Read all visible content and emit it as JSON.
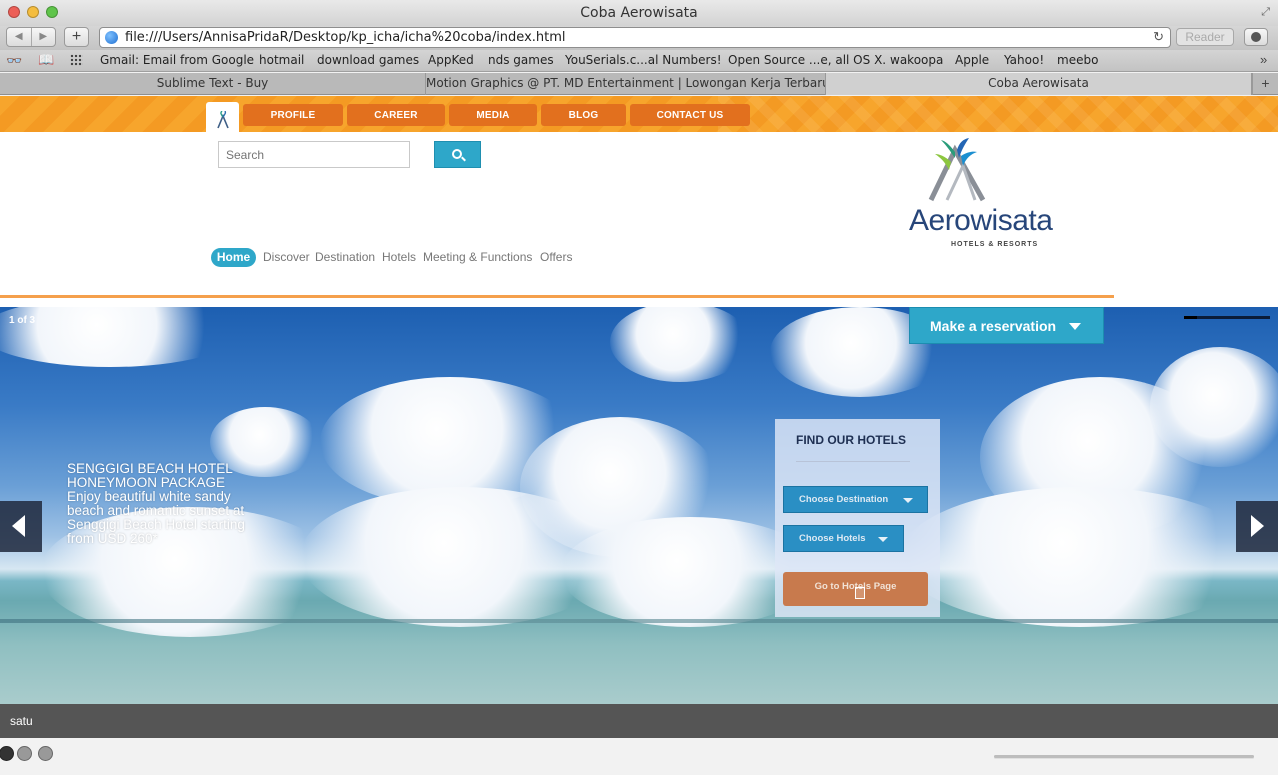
{
  "window": {
    "title": "Coba Aerowisata"
  },
  "toolbar": {
    "url": "file:///Users/AnnisaPridaR/Desktop/kp_icha/icha%20coba/index.html",
    "reader_label": "Reader"
  },
  "bookmarks": [
    "Gmail: Email from Google",
    "hotmail",
    "download games",
    "AppKed",
    "nds games",
    "YouSerials.c...al Numbers!",
    "Open Source ...e, all OS X.",
    "wakoopa",
    "Apple",
    "Yahoo!",
    "meebo"
  ],
  "tabs": [
    {
      "label": "Sublime Text - Buy",
      "active": false
    },
    {
      "label": "Motion Graphics @ PT. MD Entertainment | Lowongan Kerja Terbaru",
      "active": false
    },
    {
      "label": "Coba Aerowisata",
      "active": true
    }
  ],
  "site": {
    "topnav": [
      "PROFILE",
      "CAREER",
      "MEDIA",
      "BLOG",
      "CONTACT US"
    ],
    "search": {
      "placeholder": "Search"
    },
    "brand": {
      "name": "Aerowisata",
      "tagline": "HOTELS & RESORTS"
    },
    "subnav": {
      "active": "Home",
      "items": [
        "Discover",
        "Destination",
        "Hotels",
        "Meeting & Functions",
        "Offers"
      ]
    },
    "colors": {
      "accent_blue": "#2ea7c9",
      "nav_orange": "#e2701e",
      "brand_navy": "#27467a"
    }
  },
  "slider": {
    "counter": "1 of 3",
    "progress": 0.15,
    "reserve_label": "Make a reservation",
    "caption_lines": [
      "SENGGIGI BEACH HOTEL",
      "HONEYMOON PACKAGE",
      "Enjoy beautiful white sandy",
      "beach and romantic sunset at",
      "Senggigi Beach Hotel starting",
      "from USD 260*"
    ],
    "bottom_caption": "satu",
    "dots": 3,
    "active_dot": 0
  },
  "finder": {
    "title": "FIND OUR HOTELS",
    "destination_label": "Choose Destination",
    "hotels_label": "Choose Hotels",
    "goto_label": "Go to Hotels Page"
  }
}
